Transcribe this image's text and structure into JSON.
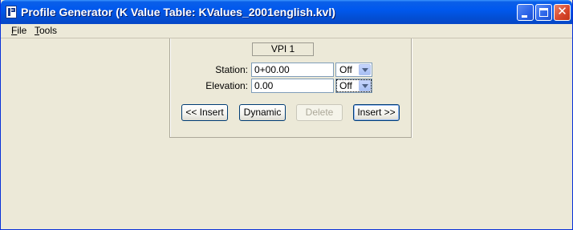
{
  "window": {
    "title": "Profile Generator  (K Value Table: KValues_2001english.kvl)"
  },
  "menu": {
    "file": {
      "mnemonic": "F",
      "rest": "ile"
    },
    "tools": {
      "mnemonic": "T",
      "rest": "ools"
    }
  },
  "vpi": {
    "label": "VPI 1"
  },
  "station": {
    "label": "Station:",
    "value": "0+00.00",
    "mode": "Off"
  },
  "elevation": {
    "label": "Elevation:",
    "value": "0.00",
    "mode": "Off"
  },
  "buttons": {
    "insert_left": "<< Insert",
    "dynamic": "Dynamic",
    "delete": "Delete",
    "insert_right": "Insert >>"
  },
  "icons": {
    "app": "profile-generator-app-icon",
    "minimize": "minimize-icon",
    "maximize": "maximize-icon",
    "close": "close-icon",
    "dropdown": "chevron-down-icon"
  },
  "colors": {
    "titlebar": "#0058ee",
    "face": "#ece9d8",
    "close": "#d6452a"
  }
}
